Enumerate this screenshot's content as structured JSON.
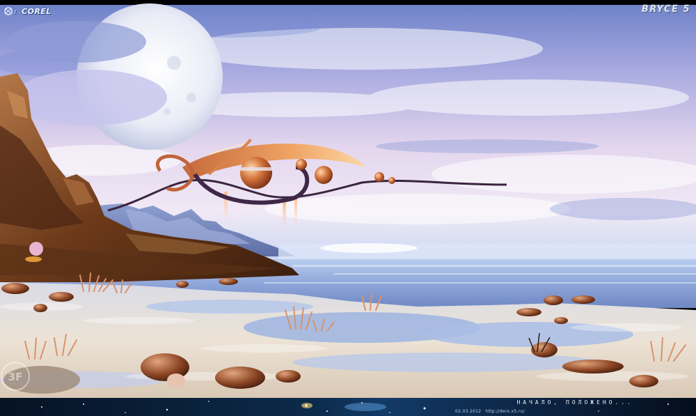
{
  "brand": {
    "left_logo": "COREL",
    "right_logo": "BRYCE 5"
  },
  "footer": {
    "title": "НАЧАЛО, ПОЛОЖЕНО...",
    "date": "02.03.2012",
    "url": "http://derx.x5.ru/"
  },
  "watermark": "3F",
  "colors": {
    "sky_top": "#7f93d6",
    "sky_mid": "#d8cdec",
    "horizon": "#c9d6f2",
    "sea": "#8ea8d8",
    "sand": "#e6dcd0",
    "rock": "#6b3b1c",
    "sculpture": "#e39a5c",
    "footer_bg": "#071528"
  }
}
